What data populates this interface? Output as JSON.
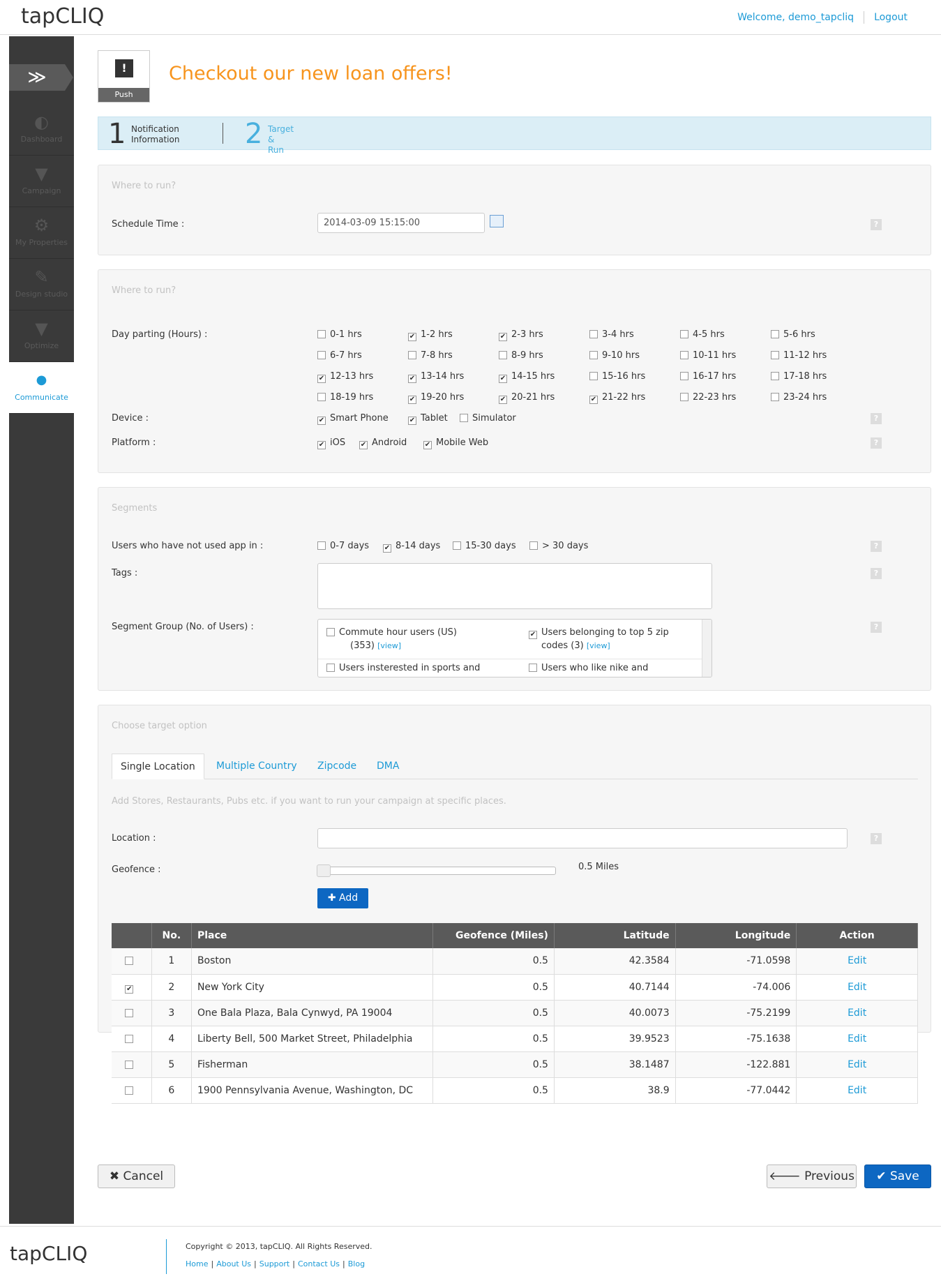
{
  "header": {
    "logo": "tapCLIQ",
    "welcome": "Welcome, demo_tapcliq",
    "logout": "Logout"
  },
  "sidebar": {
    "items": [
      {
        "label": "Dashboard",
        "icon": "gauge-icon"
      },
      {
        "label": "Campaign",
        "icon": "trophy-icon"
      },
      {
        "label": "My Properties",
        "icon": "gear-icon"
      },
      {
        "label": "Design studio",
        "icon": "design-icon"
      },
      {
        "label": "Optimize",
        "icon": "funnel-icon"
      },
      {
        "label": "Communicate",
        "icon": "chat-icon"
      }
    ]
  },
  "push": {
    "label": "Push",
    "title": "Checkout our new loan offers!"
  },
  "steps": [
    {
      "num": "1",
      "label_line1": "Notification",
      "label_line2": "Information"
    },
    {
      "num": "2",
      "label_line1": "Target &",
      "label_line2": "Run"
    }
  ],
  "schedule": {
    "heading": "Where to run?",
    "label": "Schedule Time :",
    "value": "2014-03-09 15:15:00"
  },
  "run": {
    "heading": "Where to run?",
    "day_label": "Day parting (Hours) :",
    "hours": [
      {
        "label": "0-1 hrs",
        "checked": false
      },
      {
        "label": "1-2 hrs",
        "checked": true
      },
      {
        "label": "2-3 hrs",
        "checked": true
      },
      {
        "label": "3-4 hrs",
        "checked": false
      },
      {
        "label": "4-5 hrs",
        "checked": false
      },
      {
        "label": "5-6 hrs",
        "checked": false
      },
      {
        "label": "6-7 hrs",
        "checked": false
      },
      {
        "label": "7-8 hrs",
        "checked": false
      },
      {
        "label": "8-9 hrs",
        "checked": false
      },
      {
        "label": "9-10 hrs",
        "checked": false
      },
      {
        "label": "10-11 hrs",
        "checked": false
      },
      {
        "label": "11-12 hrs",
        "checked": false
      },
      {
        "label": "12-13 hrs",
        "checked": true
      },
      {
        "label": "13-14 hrs",
        "checked": true
      },
      {
        "label": "14-15 hrs",
        "checked": true
      },
      {
        "label": "15-16 hrs",
        "checked": false
      },
      {
        "label": "16-17 hrs",
        "checked": false
      },
      {
        "label": "17-18 hrs",
        "checked": false
      },
      {
        "label": "18-19 hrs",
        "checked": false
      },
      {
        "label": "19-20 hrs",
        "checked": true
      },
      {
        "label": "20-21 hrs",
        "checked": true
      },
      {
        "label": "21-22 hrs",
        "checked": true
      },
      {
        "label": "22-23 hrs",
        "checked": false
      },
      {
        "label": "23-24 hrs",
        "checked": false
      }
    ],
    "device_label": "Device :",
    "devices": [
      {
        "label": "Smart Phone",
        "checked": true
      },
      {
        "label": "Tablet",
        "checked": true
      },
      {
        "label": "Simulator",
        "checked": false
      }
    ],
    "platform_label": "Platform :",
    "platforms": [
      {
        "label": "iOS",
        "checked": true
      },
      {
        "label": "Android",
        "checked": true
      },
      {
        "label": "Mobile Web",
        "checked": true
      }
    ]
  },
  "segments": {
    "heading": "Segments",
    "unused_label": "Users who have not used app in :",
    "unused": [
      {
        "label": "0-7 days",
        "checked": false
      },
      {
        "label": "8-14 days",
        "checked": true
      },
      {
        "label": "15-30 days",
        "checked": false
      },
      {
        "label": "> 30 days",
        "checked": false
      }
    ],
    "tags_label": "Tags :",
    "group_label": "Segment Group (No. of Users) :",
    "groups": [
      {
        "line1": "Commute hour users (US)",
        "line2": "(353)",
        "checked": false
      },
      {
        "line1": "Users belonging to top 5 zip",
        "line2": "codes (3)",
        "checked": true
      },
      {
        "line1": "Users insterested in sports and",
        "line2": "",
        "checked": false
      },
      {
        "line1": "Users who like nike and",
        "line2": "",
        "checked": false
      }
    ],
    "view": "[view]"
  },
  "target": {
    "heading": "Choose target option",
    "tabs": [
      "Single Location",
      "Multiple Country",
      "Zipcode",
      "DMA"
    ],
    "hint": "Add Stores, Restaurants, Pubs etc. if you want to run your campaign at specific places.",
    "location_label": "Location :",
    "geofence_label": "Geofence :",
    "geofence_value": "0.5 Miles",
    "add": "Add",
    "columns": [
      "No.",
      "Place",
      "Geofence (Miles)",
      "Latitude",
      "Longitude",
      "Action"
    ],
    "rows": [
      {
        "no": "1",
        "place": "Boston",
        "geofence": "0.5",
        "lat": "42.3584",
        "lng": "-71.0598",
        "action": "Edit",
        "checked": false
      },
      {
        "no": "2",
        "place": "New York City",
        "geofence": "0.5",
        "lat": "40.7144",
        "lng": "-74.006",
        "action": "Edit",
        "checked": true
      },
      {
        "no": "3",
        "place": "One Bala Plaza, Bala Cynwyd, PA 19004",
        "geofence": "0.5",
        "lat": "40.0073",
        "lng": "-75.2199",
        "action": "Edit",
        "checked": false
      },
      {
        "no": "4",
        "place": "Liberty Bell, 500 Market Street, Philadelphia",
        "geofence": "0.5",
        "lat": "39.9523",
        "lng": "-75.1638",
        "action": "Edit",
        "checked": false
      },
      {
        "no": "5",
        "place": "Fisherman",
        "geofence": "0.5",
        "lat": "38.1487",
        "lng": "-122.881",
        "action": "Edit",
        "checked": false
      },
      {
        "no": "6",
        "place": "1900 Pennsylvania Avenue, Washington, DC",
        "geofence": "0.5",
        "lat": "38.9",
        "lng": "-77.0442",
        "action": "Edit",
        "checked": false
      }
    ]
  },
  "buttons": {
    "cancel": "Cancel",
    "previous": "Previous",
    "save": "Save"
  },
  "footer": {
    "logo": "tapCLIQ",
    "copyright": "Copyright © 2013, tapCLIQ. All Rights Reserved.",
    "links": [
      "Home",
      "About Us",
      "Support",
      "Contact Us",
      "Blog"
    ]
  }
}
